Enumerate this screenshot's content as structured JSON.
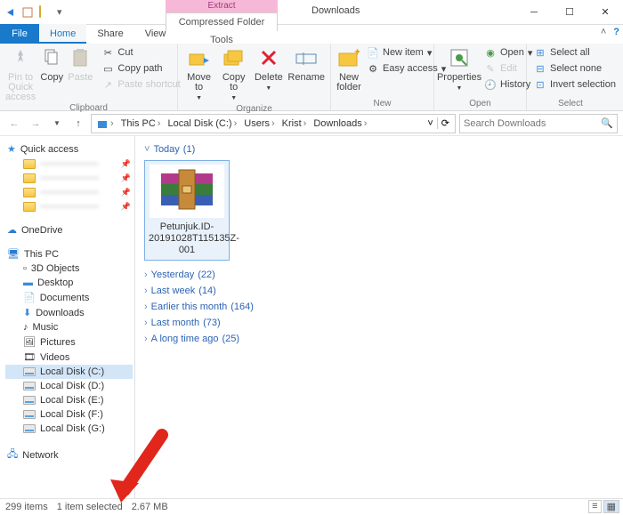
{
  "title": "Downloads",
  "context_tab_group": "Extract",
  "context_tab": "Compressed Folder Tools",
  "tabs": {
    "file": "File",
    "items": [
      "Home",
      "Share",
      "View"
    ],
    "active": 0
  },
  "ribbon": {
    "clipboard": {
      "label": "Clipboard",
      "pin": "Pin to Quick\naccess",
      "copy": "Copy",
      "paste": "Paste",
      "cut": "Cut",
      "copy_path": "Copy path",
      "paste_shortcut": "Paste shortcut"
    },
    "organize": {
      "label": "Organize",
      "move_to": "Move\nto",
      "copy_to": "Copy\nto",
      "delete": "Delete",
      "rename": "Rename"
    },
    "new": {
      "label": "New",
      "new_folder": "New\nfolder",
      "new_item": "New item",
      "easy_access": "Easy access"
    },
    "open": {
      "label": "Open",
      "properties": "Properties",
      "open": "Open",
      "edit": "Edit",
      "history": "History"
    },
    "select": {
      "label": "Select",
      "select_all": "Select all",
      "select_none": "Select none",
      "invert": "Invert selection"
    }
  },
  "breadcrumb": [
    "This PC",
    "Local Disk (C:)",
    "Users",
    "Krist",
    "Downloads"
  ],
  "search_placeholder": "Search Downloads",
  "nav": {
    "quick_access": "Quick access",
    "onedrive": "OneDrive",
    "this_pc": "This PC",
    "this_pc_items": [
      "3D Objects",
      "Desktop",
      "Documents",
      "Downloads",
      "Music",
      "Pictures",
      "Videos",
      "Local Disk (C:)",
      "Local Disk (D:)",
      "Local Disk (E:)",
      "Local Disk (F:)",
      "Local Disk (G:)"
    ],
    "network": "Network"
  },
  "groups": [
    {
      "label": "Today",
      "count": "(1)",
      "expanded": true
    },
    {
      "label": "Yesterday",
      "count": "(22)"
    },
    {
      "label": "Last week",
      "count": "(14)"
    },
    {
      "label": "Earlier this month",
      "count": "(164)"
    },
    {
      "label": "Last month",
      "count": "(73)"
    },
    {
      "label": "A long time ago",
      "count": "(25)"
    }
  ],
  "selected_file": {
    "name": "Petunjuk.ID-20191028T115135Z-001"
  },
  "status": {
    "items": "299 items",
    "selected": "1 item selected",
    "size": "2.67 MB"
  }
}
